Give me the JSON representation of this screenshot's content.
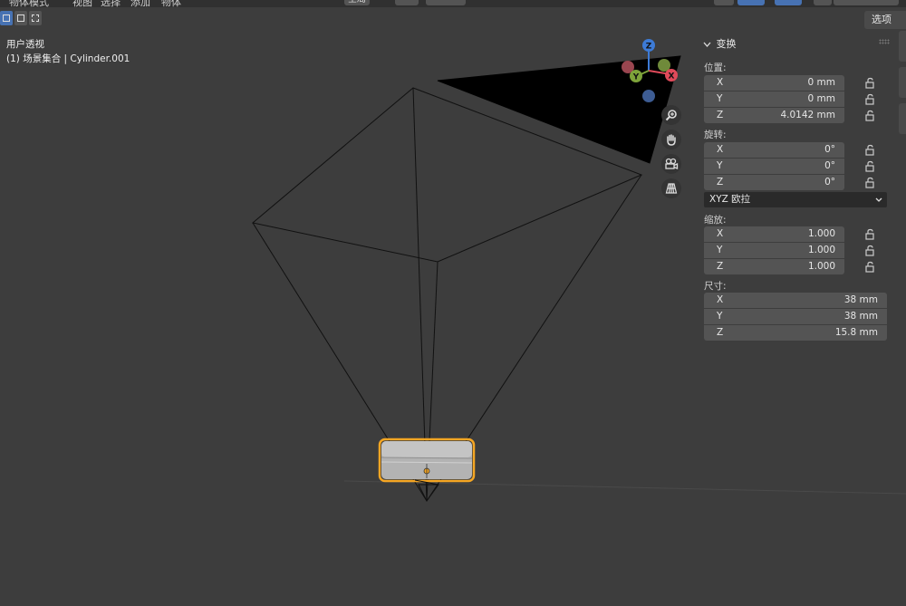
{
  "header": {
    "mode_label": "物体模式",
    "menu_view": "视图",
    "menu_select": "选择",
    "menu_add": "添加",
    "menu_object": "物体",
    "transform_orientation": "全局"
  },
  "viewport": {
    "view_name": "用户透视",
    "collection_info": "(1) 场景集合 | Cylinder.001"
  },
  "gizmo": {
    "x": "X",
    "y": "Y",
    "z": "Z"
  },
  "sidebar_toggle": "选项",
  "transform_panel": {
    "title": "变换",
    "location_label": "位置:",
    "location": [
      {
        "axis": "X",
        "value": "0 mm"
      },
      {
        "axis": "Y",
        "value": "0 mm"
      },
      {
        "axis": "Z",
        "value": "4.0142 mm"
      }
    ],
    "rotation_label": "旋转:",
    "rotation": [
      {
        "axis": "X",
        "value": "0°"
      },
      {
        "axis": "Y",
        "value": "0°"
      },
      {
        "axis": "Z",
        "value": "0°"
      }
    ],
    "rotation_mode": "XYZ 欧拉",
    "scale_label": "缩放:",
    "scale": [
      {
        "axis": "X",
        "value": "1.000"
      },
      {
        "axis": "Y",
        "value": "1.000"
      },
      {
        "axis": "Z",
        "value": "1.000"
      }
    ],
    "dimensions_label": "尺寸:",
    "dimensions": [
      {
        "axis": "X",
        "value": "38 mm"
      },
      {
        "axis": "Y",
        "value": "38 mm"
      },
      {
        "axis": "Z",
        "value": "15.8 mm"
      }
    ]
  },
  "colors": {
    "background": "#3d3d3d",
    "selection_outline": "#f5a623",
    "axis_x": "#e04a5a",
    "axis_y": "#7ea33a",
    "axis_z": "#3d7bd6"
  }
}
